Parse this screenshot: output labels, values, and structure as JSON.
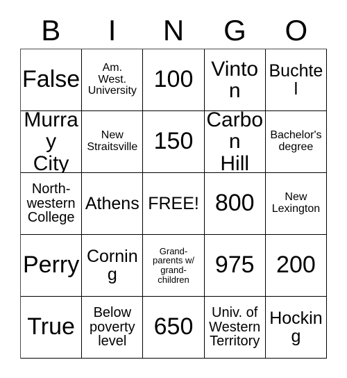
{
  "card": {
    "title": "BINGO",
    "headers": [
      "B",
      "I",
      "N",
      "G",
      "O"
    ],
    "free_space_label": "FREE!",
    "colors": {
      "background": "#ffffff",
      "text": "#000000",
      "grid_line": "#000000"
    },
    "rows": [
      [
        {
          "text": "False",
          "size": "fs-xl"
        },
        {
          "text": "Am.\nWest.\nUniversity",
          "size": "fs-xs"
        },
        {
          "text": "100",
          "size": "fs-xl"
        },
        {
          "text": "Vinton",
          "size": "fs-lg"
        },
        {
          "text": "Buchtel",
          "size": "fs-md"
        }
      ],
      [
        {
          "text": "Murray\nCity",
          "size": "fs-lg"
        },
        {
          "text": "New\nStraitsville",
          "size": "fs-xs"
        },
        {
          "text": "150",
          "size": "fs-xl"
        },
        {
          "text": "Carbon\nHill",
          "size": "fs-lg"
        },
        {
          "text": "Bachelor's\ndegree",
          "size": "fs-xs"
        }
      ],
      [
        {
          "text": "North-\nwestern\nCollege",
          "size": "fs-sm"
        },
        {
          "text": "Athens",
          "size": "fs-md"
        },
        {
          "text": "FREE!",
          "size": "fs-md"
        },
        {
          "text": "800",
          "size": "fs-xl"
        },
        {
          "text": "New\nLexington",
          "size": "fs-xs"
        }
      ],
      [
        {
          "text": "Perry",
          "size": "fs-xl"
        },
        {
          "text": "Corning",
          "size": "fs-md"
        },
        {
          "text": "Grand-\nparents w/\ngrand-\nchildren",
          "size": "fs-xxs"
        },
        {
          "text": "975",
          "size": "fs-xl"
        },
        {
          "text": "200",
          "size": "fs-xl"
        }
      ],
      [
        {
          "text": "True",
          "size": "fs-xl"
        },
        {
          "text": "Below\npoverty\nlevel",
          "size": "fs-sm"
        },
        {
          "text": "650",
          "size": "fs-xl"
        },
        {
          "text": "Univ. of\nWestern\nTerritory",
          "size": "fs-sm"
        },
        {
          "text": "Hocking",
          "size": "fs-md"
        }
      ]
    ]
  }
}
